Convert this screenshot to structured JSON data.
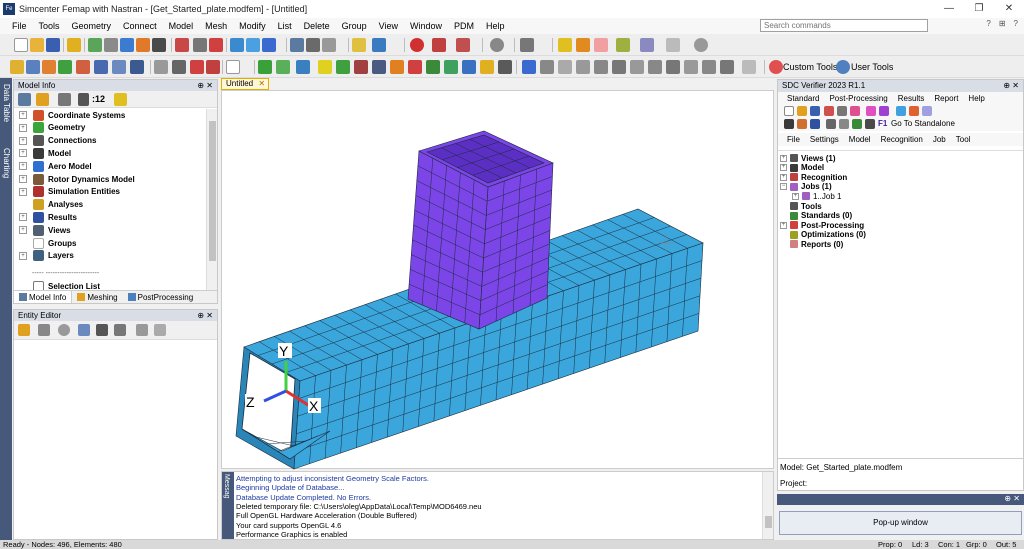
{
  "window": {
    "app_icon": "Fe",
    "title": "Simcenter Femap with Nastran - [Get_Started_plate.modfem] - [Untitled]",
    "min_glyph": "—",
    "max_glyph": "❐",
    "close_glyph": "✕"
  },
  "menu": [
    "File",
    "Tools",
    "Geometry",
    "Connect",
    "Model",
    "Mesh",
    "Modify",
    "List",
    "Delete",
    "Group",
    "View",
    "Window",
    "PDM",
    "Help"
  ],
  "search": {
    "placeholder": "Search commands"
  },
  "help_icons": [
    "?",
    "⊞",
    "?"
  ],
  "toolbar3": {
    "custom_tools": "Custom Tools",
    "user_tools": "User Tools"
  },
  "left_rail": {
    "data_table": "Data Table",
    "charting": "Charting"
  },
  "model_info": {
    "title": "Model Info",
    "pin": "⊕ ✕",
    "label_count": ":12",
    "tree": [
      {
        "label": "Coordinate Systems",
        "expander": "+",
        "color": "#d0502a"
      },
      {
        "label": "Geometry",
        "expander": "+",
        "color": "#3aa53a"
      },
      {
        "label": "Connections",
        "expander": "+",
        "color": "#555555"
      },
      {
        "label": "Model",
        "expander": "+",
        "color": "#3a3a3a"
      },
      {
        "label": "Aero Model",
        "expander": "+",
        "color": "#2f6fd0"
      },
      {
        "label": "Rotor Dynamics Model",
        "expander": "+",
        "color": "#7a5a3a"
      },
      {
        "label": "Simulation Entities",
        "expander": "+",
        "color": "#b03030"
      },
      {
        "label": "Analyses",
        "expander": "",
        "color": "#d0a020"
      },
      {
        "label": "Results",
        "expander": "+",
        "color": "#3050a0"
      },
      {
        "label": "Views",
        "expander": "+",
        "color": "#506070"
      },
      {
        "label": "Groups",
        "expander": "",
        "color": "#ffffff"
      },
      {
        "label": "Layers",
        "expander": "+",
        "color": "#406080"
      }
    ],
    "separator": "----- -----------------------",
    "selection_list": "Selection List",
    "tabs": [
      "Model Info",
      "Meshing",
      "PostProcessing"
    ]
  },
  "entity_editor": {
    "title": "Entity Editor",
    "pin": "⊕ ✕"
  },
  "doc_tab": {
    "label": "Untitled",
    "close": "✕"
  },
  "axes": {
    "y": "Y",
    "z": "Z",
    "x": "X"
  },
  "messages": {
    "rail_label": "Messag",
    "lines": [
      {
        "text": "Attempting to adjust inconsistent Geometry Scale Factors.",
        "color": "#1f3aa0"
      },
      {
        "text": "Beginning Update of Database...",
        "color": "#1f3aa0"
      },
      {
        "text": "Database Update Completed. No Errors.",
        "color": "#1f3aa0"
      },
      {
        "text": "Deleted temporary file: C:\\Users\\oleg\\AppData\\Local\\Temp\\MOD6469.neu",
        "color": "#000000"
      },
      {
        "text": "Full OpenGL Hardware Acceleration (Double Buffered)",
        "color": "#000000"
      },
      {
        "text": "Your card supports OpenGL 4.6",
        "color": "#000000"
      },
      {
        "text": "Performance Graphics is enabled",
        "color": "#000000"
      }
    ]
  },
  "sdc": {
    "title": "SDC Verifier 2023 R1.1",
    "pin": "⊕ ✕",
    "menu1": [
      "Standard",
      "Post-Processing",
      "Results",
      "Report",
      "Help"
    ],
    "go_standalone": "Go To Standalone",
    "f1": "F1",
    "menu2": [
      "File",
      "Settings",
      "Model",
      "Recognition",
      "Job",
      "Tool"
    ],
    "tree": [
      {
        "label": "Views (1)",
        "expander": "+",
        "bold": true,
        "indent": 0
      },
      {
        "label": "Model",
        "expander": "+",
        "bold": true,
        "indent": 0
      },
      {
        "label": "Recognition",
        "expander": "+",
        "bold": true,
        "indent": 0
      },
      {
        "label": "Jobs (1)",
        "expander": "−",
        "bold": true,
        "indent": 0
      },
      {
        "label": "1..Job 1",
        "expander": "+",
        "bold": false,
        "indent": 12
      },
      {
        "label": "Tools",
        "expander": "",
        "bold": true,
        "indent": 0
      },
      {
        "label": "Standards (0)",
        "expander": "",
        "bold": true,
        "indent": 0
      },
      {
        "label": "Post-Processing",
        "expander": "+",
        "bold": true,
        "indent": 0
      },
      {
        "label": "Optimizations (0)",
        "expander": "",
        "bold": true,
        "indent": 0
      },
      {
        "label": "Reports (0)",
        "expander": "",
        "bold": true,
        "indent": 0
      }
    ],
    "model_label": "Model: Get_Started_plate.modfem",
    "project_label": "Project:"
  },
  "popup": {
    "pin": "⊕ ✕",
    "button": "Pop-up window"
  },
  "status": {
    "left": "Ready - Nodes: 496, Elements: 480",
    "prop": "Prop: 0",
    "ld": "Ld: 3",
    "con": "Con: 1",
    "grp": "Grp: 0",
    "out": "Out: 5"
  },
  "colors": {
    "beam": "#3aa6dc",
    "beam_dark": "#2a86b8",
    "box": "#7b45e8",
    "box_dark": "#5c2fc4",
    "rail": "#46597a"
  }
}
